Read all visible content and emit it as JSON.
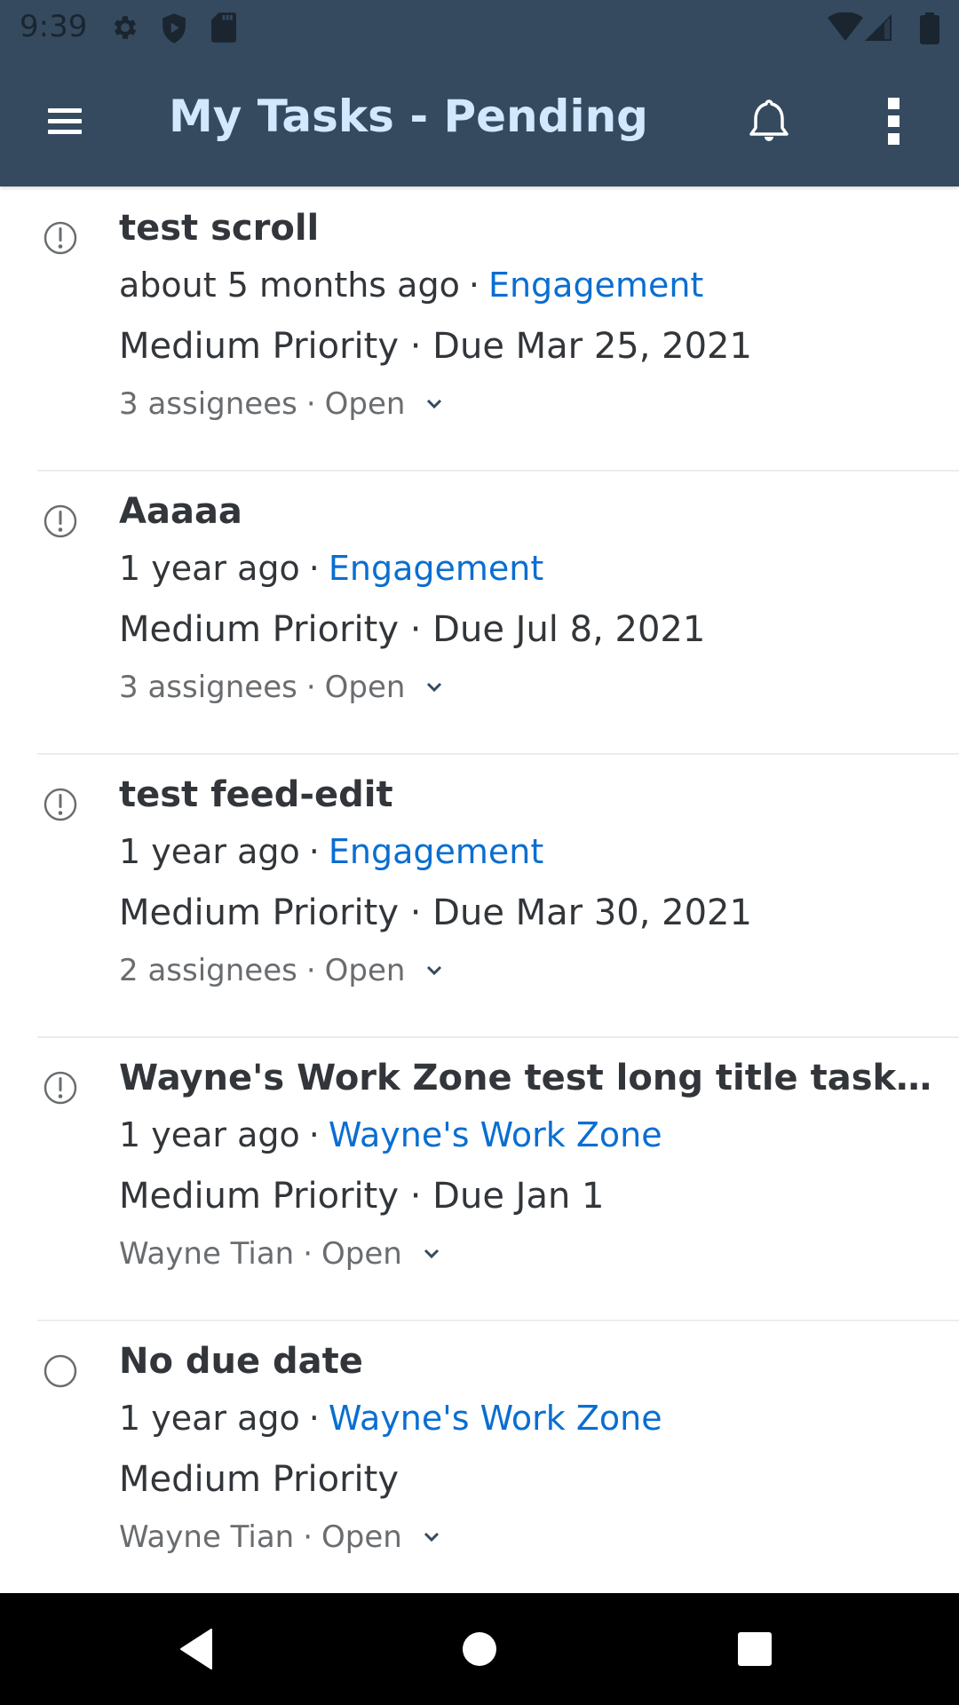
{
  "status_bar": {
    "time": "9:39",
    "left_icons": [
      "gear-icon",
      "shield-play-icon",
      "sd-card-icon"
    ],
    "right_icons": [
      "wifi-icon",
      "cell-signal-icon",
      "battery-icon"
    ]
  },
  "app_bar": {
    "title": "My Tasks - Pending",
    "menu_icon": "hamburger-menu-icon",
    "notifications_icon": "bell-icon",
    "overflow_icon": "more-vertical-icon"
  },
  "colors": {
    "app_bar_bg": "#354a5f",
    "title_text": "#d1e8ff",
    "link": "#0a6ed1",
    "primary_text": "#32363a",
    "secondary_text": "#6a6d70"
  },
  "separator": "·",
  "tasks": [
    {
      "icon": "exclamation-circle-icon",
      "title": "test scroll",
      "age": "about 5 months ago",
      "group": "Engagement",
      "priority_due": "Medium Priority · Due Mar 25, 2021",
      "assignees": "3 assignees",
      "status": "Open"
    },
    {
      "icon": "exclamation-circle-icon",
      "title": "Aaaaa",
      "age": "1 year ago",
      "group": "Engagement",
      "priority_due": "Medium Priority · Due Jul 8, 2021",
      "assignees": "3 assignees",
      "status": "Open"
    },
    {
      "icon": "exclamation-circle-icon",
      "title": "test feed-edit",
      "age": "1 year ago",
      "group": "Engagement",
      "priority_due": "Medium Priority · Due Mar 30, 2021",
      "assignees": "2 assignees",
      "status": "Open"
    },
    {
      "icon": "exclamation-circle-icon",
      "title": "Wayne's Work Zone test long title task,S...",
      "age": "1 year ago",
      "group": "Wayne's Work Zone",
      "priority_due": "Medium Priority · Due Jan 1",
      "assignees": "Wayne Tian",
      "status": "Open"
    },
    {
      "icon": "empty-circle-icon",
      "title": "No due date",
      "age": "1 year ago",
      "group": "Wayne's Work Zone",
      "priority_due": "Medium Priority",
      "assignees": "Wayne Tian",
      "status": "Open"
    }
  ],
  "nav_bar": {
    "back": "back-triangle-icon",
    "home": "home-circle-icon",
    "recents": "recents-square-icon"
  }
}
